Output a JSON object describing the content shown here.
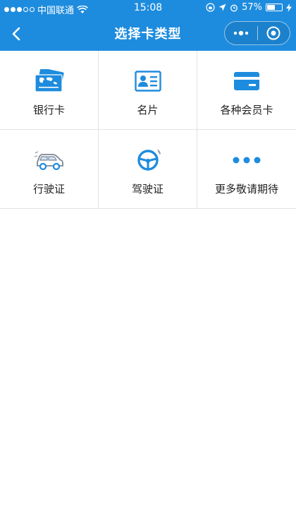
{
  "status_bar": {
    "carrier": "中国联通",
    "time": "15:08",
    "battery": "57%",
    "battery_level": 0.57
  },
  "nav": {
    "title": "选择卡类型"
  },
  "card_types": [
    {
      "label": "银行卡",
      "icon": "bank-card-icon"
    },
    {
      "label": "名片",
      "icon": "business-card-icon"
    },
    {
      "label": "各种会员卡",
      "icon": "membership-card-icon"
    },
    {
      "label": "行驶证",
      "icon": "car-icon"
    },
    {
      "label": "驾驶证",
      "icon": "steering-wheel-icon"
    },
    {
      "label": "更多敬请期待",
      "icon": "more-dots-icon"
    }
  ],
  "colors": {
    "primary": "#1e8cde",
    "divider": "#e2e2e2"
  }
}
